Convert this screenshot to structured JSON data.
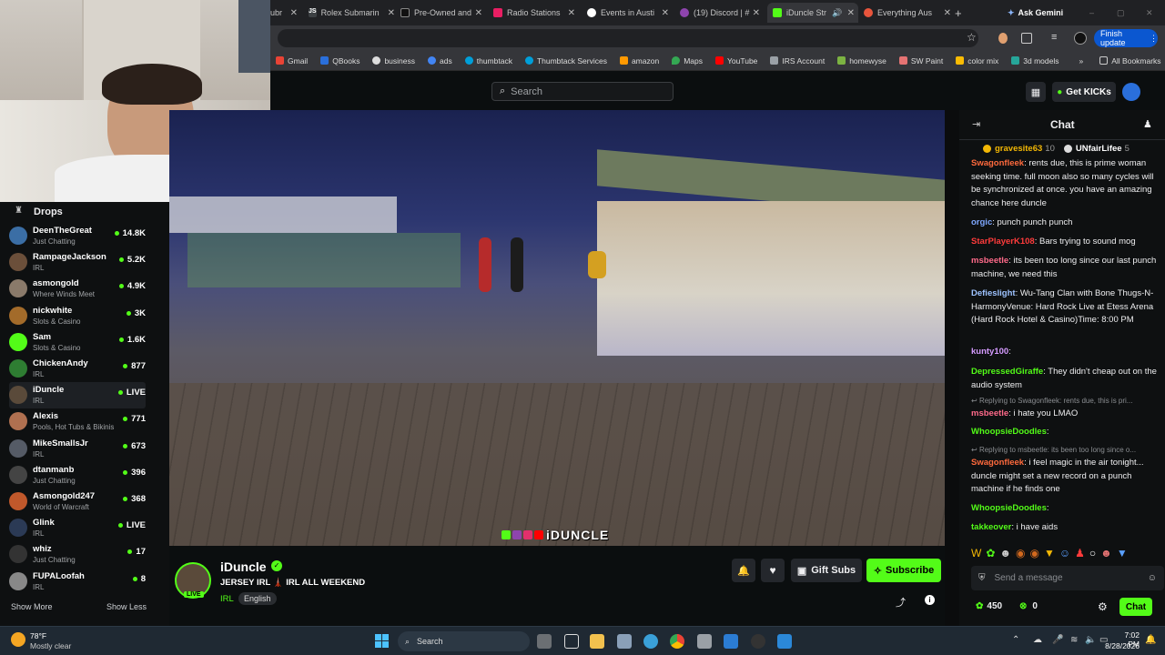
{
  "browser": {
    "tabs": [
      {
        "label": "ubr",
        "color": "#5f6368"
      },
      {
        "label": "Rolex Submarin",
        "color": "#3c4043",
        "icon": "JS"
      },
      {
        "label": "Pre-Owned and",
        "color": "#111111"
      },
      {
        "label": "Radio Stations",
        "color": "#e91e63"
      },
      {
        "label": "Events in Austi",
        "color": "#ffffff"
      },
      {
        "label": "(19) Discord | #",
        "color": "#8e44ad"
      },
      {
        "label": "iDuncle Str",
        "color": "#53fc18"
      },
      {
        "label": "Everything Aus",
        "color": "#e8553c"
      }
    ],
    "ask_gemini": "Ask Gemini",
    "finish_update": "Finish update",
    "bookmarks": [
      {
        "label": "Gmail",
        "color": "#ea4335"
      },
      {
        "label": "QBooks",
        "color": "#2a6fdb"
      },
      {
        "label": "business",
        "color": "#dddddd"
      },
      {
        "label": "ads",
        "color": "#4285f4"
      },
      {
        "label": "thumbtack",
        "color": "#009fd9"
      },
      {
        "label": "Thumbtack Services",
        "color": "#009fd9"
      },
      {
        "label": "amazon",
        "color": "#ff9900"
      },
      {
        "label": "Maps",
        "color": "#34a853"
      },
      {
        "label": "YouTube",
        "color": "#ff0000"
      },
      {
        "label": "IRS Account",
        "color": "#9aa0a6"
      },
      {
        "label": "homewyse",
        "color": "#7cb342"
      },
      {
        "label": "SW Paint",
        "color": "#e57373"
      },
      {
        "label": "color mix",
        "color": "#fbbc04"
      },
      {
        "label": "3d models",
        "color": "#26a69a"
      }
    ],
    "all_bookmarks": "All Bookmarks"
  },
  "kick": {
    "search_placeholder": "Search",
    "get_kicks": "Get KICKs",
    "accent": "#53fc18"
  },
  "sidebar": {
    "title": "Drops",
    "channels": [
      {
        "name": "DeenTheGreat",
        "category": "Just Chatting",
        "viewers": "14.8K",
        "color": "#3b6ea5"
      },
      {
        "name": "RampageJackson",
        "category": "IRL",
        "viewers": "5.2K",
        "color": "#6b4f3a"
      },
      {
        "name": "asmongold",
        "category": "Where Winds Meet",
        "viewers": "4.9K",
        "color": "#8a7a6a"
      },
      {
        "name": "nickwhite",
        "category": "Slots & Casino",
        "viewers": "3K",
        "color": "#a36b2a"
      },
      {
        "name": "Sam",
        "category": "Slots & Casino",
        "viewers": "1.6K",
        "color": "#53fc18"
      },
      {
        "name": "ChickenAndy",
        "category": "IRL",
        "viewers": "877",
        "color": "#2e7d32"
      },
      {
        "name": "iDuncle",
        "category": "IRL",
        "viewers": "LIVE",
        "color": "#5a4a3a"
      },
      {
        "name": "Alexis",
        "category": "Pools, Hot Tubs & Bikinis",
        "viewers": "771",
        "color": "#b07050"
      },
      {
        "name": "MikeSmallsJr",
        "category": "IRL",
        "viewers": "673",
        "color": "#555b66"
      },
      {
        "name": "dtanmanb",
        "category": "Just Chatting",
        "viewers": "396",
        "color": "#444444"
      },
      {
        "name": "Asmongold247",
        "category": "World of Warcraft",
        "viewers": "368",
        "color": "#c0582b"
      },
      {
        "name": "Glink",
        "category": "IRL",
        "viewers": "LIVE",
        "color": "#2b3a55"
      },
      {
        "name": "whiz",
        "category": "Just Chatting",
        "viewers": "17",
        "color": "#333333"
      },
      {
        "name": "FUPALoofah",
        "category": "IRL",
        "viewers": "8",
        "color": "#888888"
      }
    ],
    "show_more": "Show More",
    "show_less": "Show Less"
  },
  "player": {
    "watermark": "iDUNCLE"
  },
  "stream": {
    "streamer": "iDuncle",
    "live_badge": "LIVE",
    "title": "JERSEY IRL 🗼 IRL ALL WEEKEND",
    "category": "IRL",
    "language": "English",
    "gift_subs": "Gift Subs",
    "subscribe": "Subscribe"
  },
  "chat": {
    "title": "Chat",
    "pinned": [
      {
        "name": "gravesite63",
        "count": "10"
      },
      {
        "name": "UNfairLifee",
        "count": "5"
      }
    ],
    "messages": [
      {
        "user": "Swagonfleek",
        "color": "#ff6a3d",
        "text": ": rents due, this is prime woman seeking time. full moon also so many cycles will be synchronized at once. you have an amazing chance here duncle"
      },
      {
        "user": "orgic",
        "color": "#7fa8ff",
        "text": ": punch punch punch"
      },
      {
        "user": "StarPlayerK108",
        "color": "#ff3b3b",
        "text": ": Bars trying to sound mog"
      },
      {
        "user": "msbeetle",
        "color": "#ff6a8a",
        "text": ": its been too long since our last punch machine, we need this"
      },
      {
        "user": "Defieslight",
        "color": "#9ec3ff",
        "text": ": Wu-Tang Clan with Bone Thugs-N-HarmonyVenue: Hard Rock Live at Etess Arena (Hard Rock Hotel & Casino)Time: 8:00 PM"
      },
      {
        "user": "kunty100",
        "color": "#d59bff",
        "text": ":"
      },
      {
        "user": "DepressedGiraffe",
        "color": "#53fc18",
        "text": ": They didn't cheap out on the audio system"
      },
      {
        "user": "msbeetle",
        "color": "#ff6a8a",
        "text": ": i hate you LMAO",
        "reply": "Replying to Swagonfleek: rents due, this is pri..."
      },
      {
        "user": "WhoopsieDoodles",
        "color": "#53fc18",
        "text": ":"
      },
      {
        "user": "Swagonfleek",
        "color": "#ff6a3d",
        "text": ": i feel magic in the air tonight... duncle might set a new record on a punch machine if he finds one",
        "reply": "Replying to msbeetle: its been too long since o..."
      },
      {
        "user": "WhoopsieDoodles",
        "color": "#53fc18",
        "text": ":"
      },
      {
        "user": "takkeover",
        "color": "#53fc18",
        "text": ": i have aids"
      }
    ],
    "input_placeholder": "Send a message",
    "points": "450",
    "kicks": "0",
    "send": "Chat"
  },
  "taskbar": {
    "weather_temp": "78°F",
    "weather_desc": "Mostly clear",
    "search": "Search",
    "time": "7:02 PM",
    "date": "8/28/2026"
  }
}
